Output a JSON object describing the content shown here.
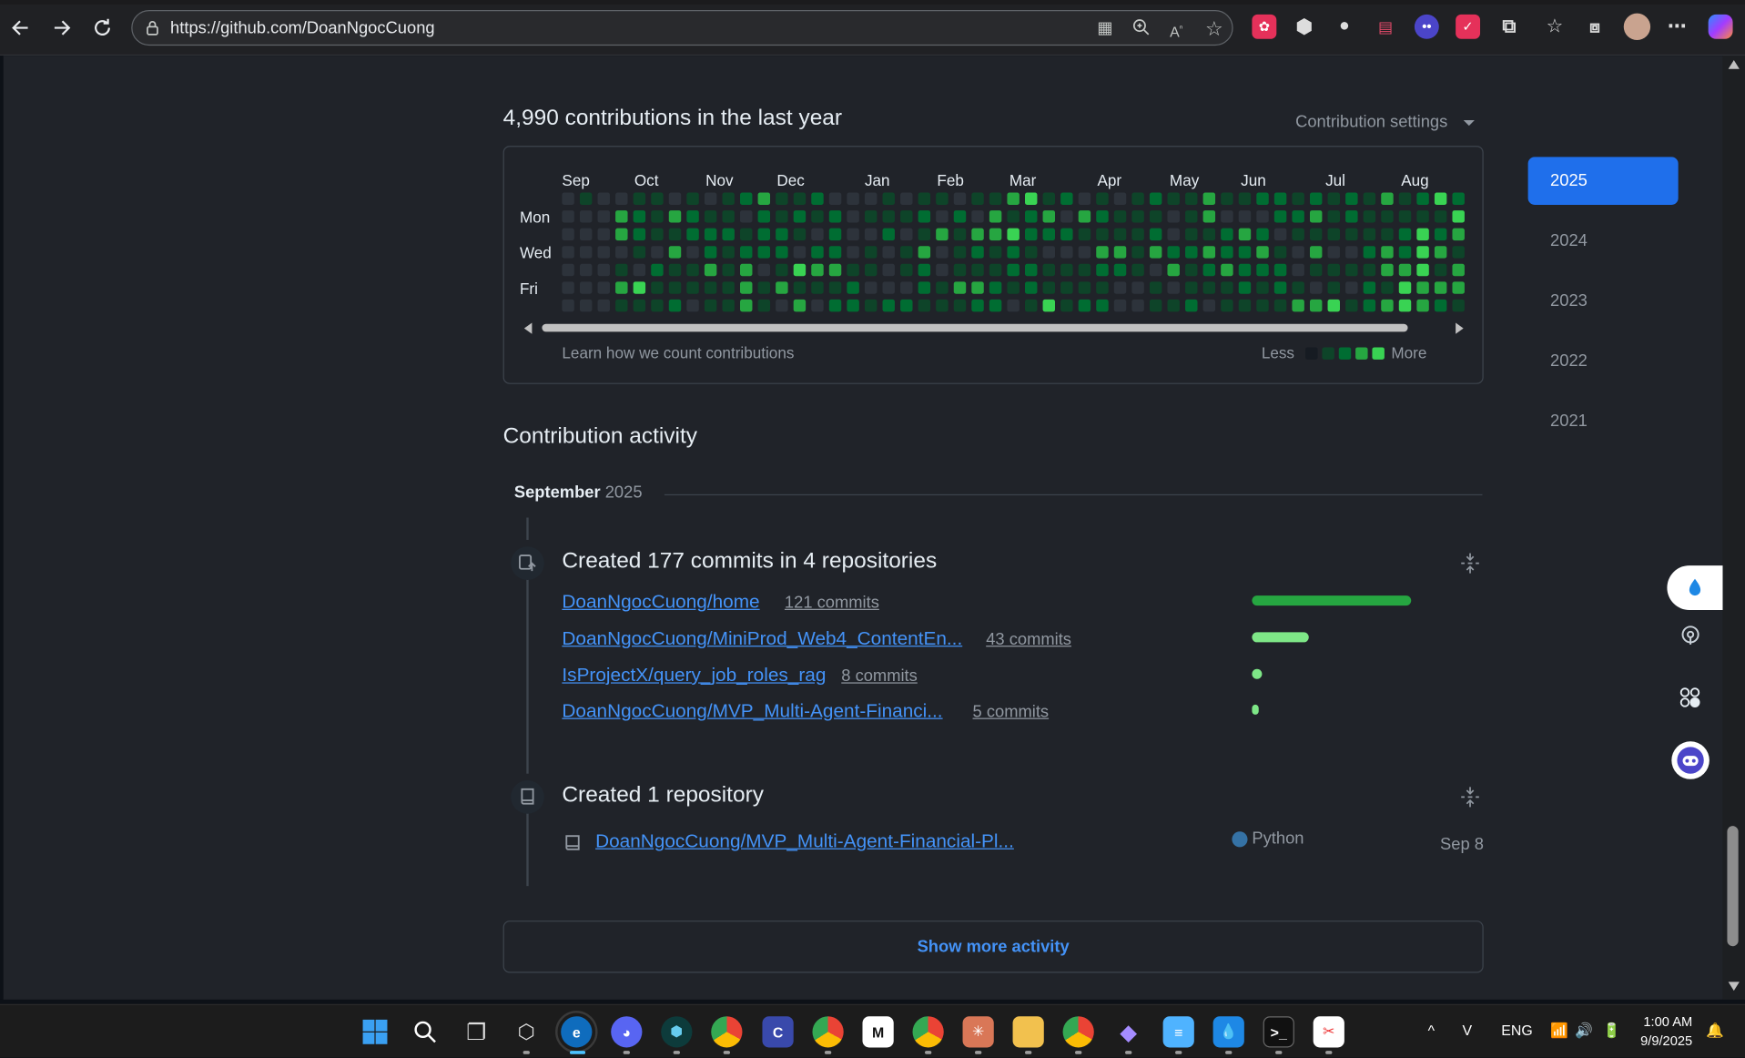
{
  "browser": {
    "url": "https://github.com/DoanNgocCuong",
    "icons": [
      "back-icon",
      "forward-icon",
      "refresh-icon",
      "lock-icon",
      "app-icon",
      "zoom-icon",
      "read-aloud-icon",
      "favorite-icon",
      "extensions-icon",
      "favorites-icon",
      "collections-icon",
      "profile-avatar",
      "more-icon",
      "copilot-icon"
    ]
  },
  "contributions": {
    "heading": "4,990 contributions in the last year",
    "settings_label": "Contribution settings",
    "months": [
      "Sep",
      "Oct",
      "Nov",
      "Dec",
      "Jan",
      "Feb",
      "Mar",
      "Apr",
      "May",
      "Jun",
      "Jul",
      "Aug"
    ],
    "day_labels": [
      "Mon",
      "Wed",
      "Fri"
    ],
    "learn_link": "Learn how we count contributions",
    "legend_less": "Less",
    "legend_more": "More",
    "level_colors": [
      "#2d333b",
      "#0e4429",
      "#006d32",
      "#26a641",
      "#39d353"
    ],
    "legend_colors": [
      "#161b22",
      "#0e4429",
      "#006d32",
      "#26a641",
      "#39d353"
    ]
  },
  "years": {
    "items": [
      "2025",
      "2024",
      "2023",
      "2022",
      "2021"
    ],
    "selected": "2025"
  },
  "activity": {
    "heading": "Contribution activity",
    "month_label": "September",
    "month_year": "2025",
    "commits_event": {
      "title": "Created 177 commits in 4 repositories",
      "repos": [
        {
          "name": "DoanNgocCuong/home",
          "commits": "121 commits",
          "count": 121
        },
        {
          "name": "DoanNgocCuong/MiniProd_Web4_ContentEn...",
          "commits": "43 commits",
          "count": 43
        },
        {
          "name": "IsProjectX/query_job_roles_rag",
          "commits": "8 commits",
          "count": 8
        },
        {
          "name": "DoanNgocCuong/MVP_Multi-Agent-Financi...",
          "commits": "5 commits",
          "count": 5
        }
      ],
      "bar_colors": [
        "#26a641",
        "#7ee787",
        "#7ee787",
        "#7ee787"
      ]
    },
    "repo_event": {
      "title": "Created 1 repository",
      "repo_name": "DoanNgocCuong/MVP_Multi-Agent-Financial-Pl...",
      "language": "Python",
      "language_color": "#3572a5",
      "date": "Sep 8"
    },
    "show_more": "Show more activity"
  },
  "taskbar": {
    "lang": "ENG",
    "time": "1:00 AM",
    "date": "9/9/2025"
  }
}
